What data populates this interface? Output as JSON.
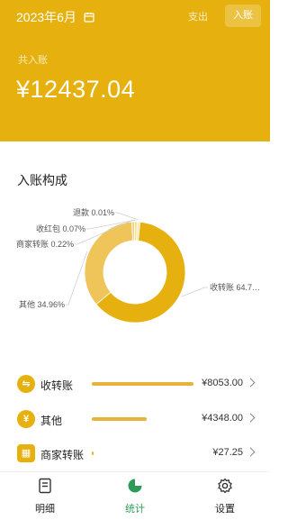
{
  "header": {
    "month": "2023年6月",
    "tab_expense": "支出",
    "tab_income": "入账",
    "total_label": "共入账",
    "total_amount": "¥12437.04",
    "colors": {
      "brand": "#e6b10e"
    }
  },
  "section": {
    "title": "入账构成"
  },
  "chart_data": {
    "type": "pie",
    "donut": true,
    "slices": [
      {
        "label": "收转账",
        "percent_label": "64.7…",
        "value": 64.75,
        "color": "#e6b10e"
      },
      {
        "label": "其他",
        "percent_label": "34.96%",
        "value": 34.96,
        "color": "#efc55a"
      },
      {
        "label": "商家转账",
        "percent_label": "0.22%",
        "value": 0.22,
        "color": "#f3d37e"
      },
      {
        "label": "收红包",
        "percent_label": "0.07%",
        "value": 0.07,
        "color": "#f6dd98"
      },
      {
        "label": "退款",
        "percent_label": "0.01%",
        "value": 0.01,
        "color": "#f9e6b2"
      }
    ]
  },
  "rows": [
    {
      "name": "收转账",
      "amount": "¥8053.00",
      "fraction": 1.0,
      "icon": "transfer-icon"
    },
    {
      "name": "其他",
      "amount": "¥4348.00",
      "fraction": 0.54,
      "icon": "yuan-icon"
    },
    {
      "name": "商家转账",
      "amount": "¥27.25",
      "fraction": 0.02,
      "icon": "merchant-icon"
    }
  ],
  "tabbar": [
    {
      "label": "明细",
      "icon": "document-icon"
    },
    {
      "label": "统计",
      "icon": "pie-chart-icon",
      "active": true
    },
    {
      "label": "设置",
      "icon": "gear-icon"
    }
  ]
}
